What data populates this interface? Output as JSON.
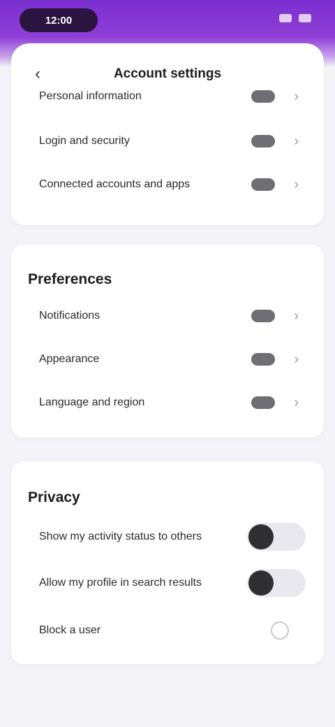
{
  "status_bar": {
    "time": "12:00"
  },
  "header": {
    "title": "Account settings"
  },
  "sections": {
    "top": {
      "items": [
        {
          "label": "Personal information"
        },
        {
          "label": "Login and security"
        },
        {
          "label": "Connected accounts and apps"
        }
      ]
    },
    "preferences": {
      "title": "Preferences",
      "items": [
        {
          "label": "Notifications"
        },
        {
          "label": "Appearance"
        },
        {
          "label": "Language and region"
        }
      ]
    },
    "privacy": {
      "title": "Privacy",
      "items": [
        {
          "label": "Show my activity status to others",
          "control": "toggle",
          "on": false
        },
        {
          "label": "Allow my profile in search results",
          "control": "toggle",
          "on": false
        },
        {
          "label": "Block a user",
          "control": "radio",
          "on": false
        }
      ]
    }
  },
  "colors": {
    "accent": "#8a3ad5",
    "background": "#f4f3f8"
  }
}
